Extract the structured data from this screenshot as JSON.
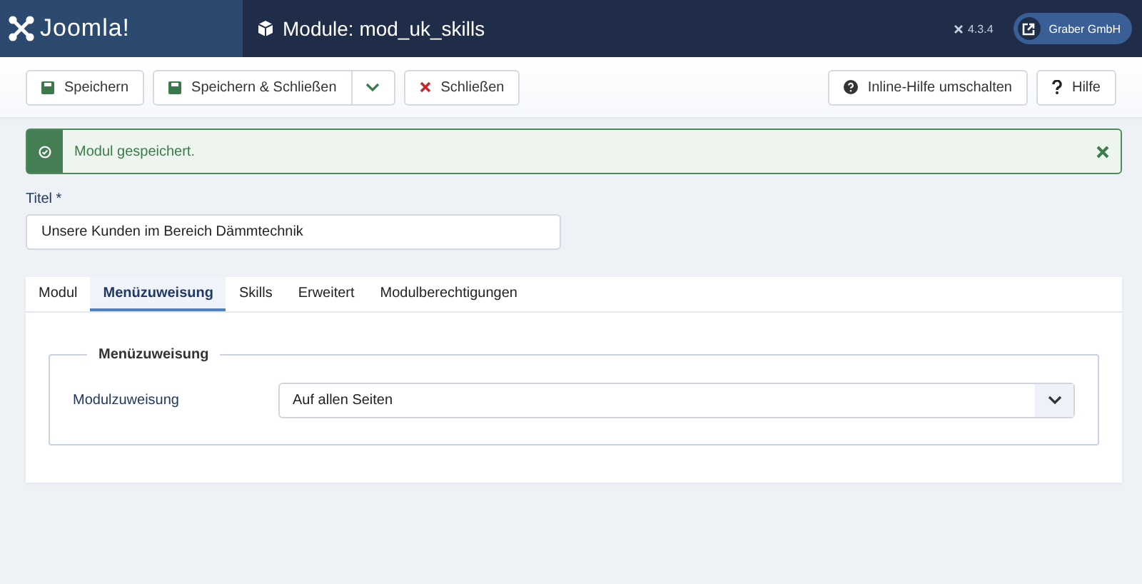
{
  "header": {
    "brand": "Joomla!",
    "title": "Module: mod_uk_skills",
    "version": "4.3.4",
    "user": "Graber GmbH"
  },
  "toolbar": {
    "left": [
      {
        "label": "Speichern",
        "kind": "save"
      },
      {
        "label": "Speichern & Schließen",
        "kind": "save-dropdown"
      },
      {
        "label": "Schließen",
        "kind": "close"
      }
    ],
    "right": [
      {
        "label": "Inline-Hilfe umschalten",
        "kind": "help-toggle"
      },
      {
        "label": "Hilfe",
        "kind": "help"
      }
    ]
  },
  "alert": {
    "message": "Modul gespeichert."
  },
  "title_field": {
    "label": "Titel *",
    "value": "Unsere Kunden im Bereich Dämmtechnik"
  },
  "tabs": [
    {
      "label": "Modul",
      "selected": false
    },
    {
      "label": "Menüzuweisung",
      "selected": true
    },
    {
      "label": "Skills",
      "selected": false
    },
    {
      "label": "Erweitert",
      "selected": false
    },
    {
      "label": "Modulberechtigungen",
      "selected": false
    }
  ],
  "fieldset": {
    "legend": "Menüzuweisung",
    "label": "Modulzuweisung",
    "value": "Auf allen Seiten"
  }
}
